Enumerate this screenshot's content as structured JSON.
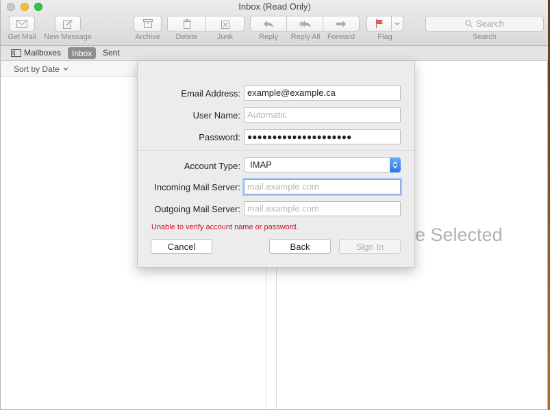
{
  "window": {
    "title": "Inbox (Read Only)"
  },
  "toolbar": {
    "get_mail": "Get Mail",
    "new_message": "New Message",
    "archive": "Archive",
    "delete": "Delete",
    "junk": "Junk",
    "reply": "Reply",
    "reply_all": "Reply All",
    "forward": "Forward",
    "flag": "Flag",
    "search_placeholder": "Search",
    "search_label": "Search"
  },
  "favorites": {
    "mailboxes": "Mailboxes",
    "inbox": "Inbox",
    "sent": "Sent"
  },
  "list": {
    "sort_label": "Sort by Date"
  },
  "viewer": {
    "partial_text": "e Selected"
  },
  "dialog": {
    "email_label": "Email Address:",
    "email_value": "example@example.ca",
    "username_label": "User Name:",
    "username_placeholder": "Automatic",
    "password_label": "Password:",
    "password_value": "●●●●●●●●●●●●●●●●●●●●●",
    "account_type_label": "Account Type:",
    "account_type_value": "IMAP",
    "incoming_label": "Incoming Mail Server:",
    "incoming_placeholder": "mail.example.com",
    "outgoing_label": "Outgoing Mail Server:",
    "outgoing_placeholder": "mail.example.com",
    "error": "Unable to verify account name or password.",
    "cancel": "Cancel",
    "back": "Back",
    "sign_in": "Sign In"
  },
  "colors": {
    "error": "#c8102e",
    "focus_ring": "#a7c5f1",
    "flag": "#e8554e"
  }
}
